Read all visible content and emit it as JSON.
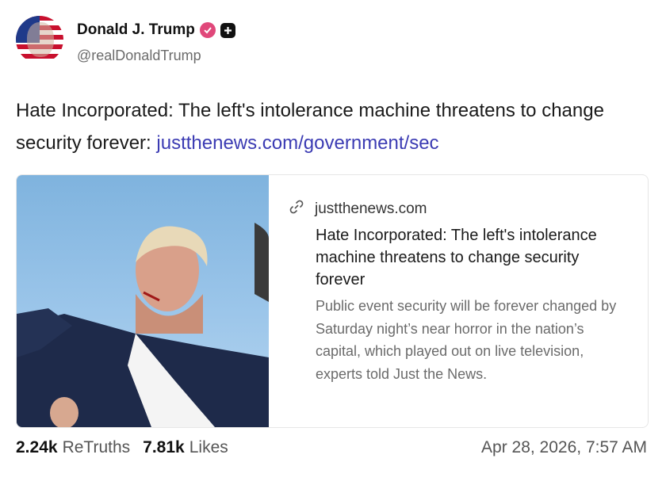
{
  "author": {
    "display_name": "Donald J. Trump",
    "handle": "@realDonaldTrump",
    "avatar_icon": "flag-portrait-avatar",
    "verified_icon": "verified-check-icon",
    "verified_color": "#e0487a",
    "plus_icon": "plus-badge-icon"
  },
  "post": {
    "text": "Hate Incorporated: The left's intolerance machine threatens to change security forever: ",
    "link": "justthenews.com/government/sec",
    "link_color": "#3b3bb3"
  },
  "card": {
    "image_icon": "news-photo",
    "link_icon": "link-icon",
    "domain": "justthenews.com",
    "title": "Hate Incorporated: The left's intolerance machine threatens to change security forever",
    "description": "Public event security will be forever changed by Saturday night’s near horror in the nation’s capital, which played out on live television, experts told Just the News."
  },
  "stats": {
    "retruths_count": "2.24k",
    "retruths_label": "ReTruths",
    "likes_count": "7.81k",
    "likes_label": "Likes"
  },
  "timestamp": "Apr 28, 2026, 7:57 AM"
}
